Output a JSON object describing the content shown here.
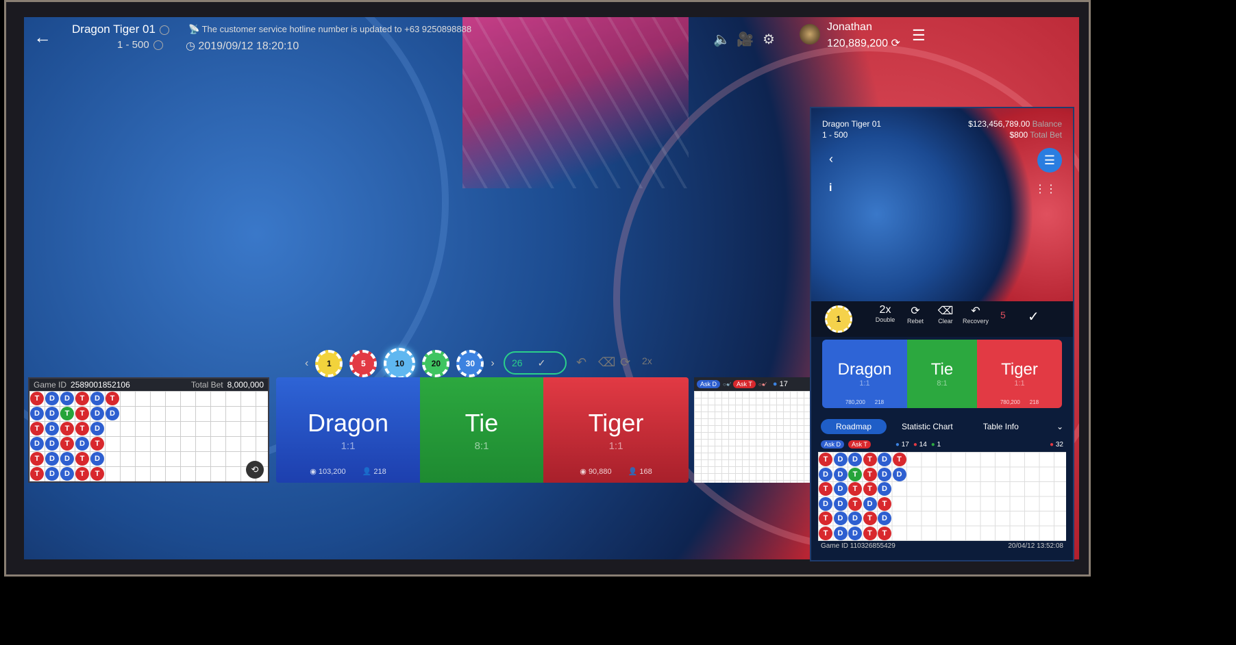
{
  "header": {
    "table_name": "Dragon Tiger 01",
    "limit": "1 - 500",
    "hotline": "The customer service hotline number is updated to +63 9250898888",
    "datetime": "2019/09/12 18:20:10",
    "username": "Jonathan",
    "balance": "120,889,200"
  },
  "chips": [
    "1",
    "5",
    "10",
    "20",
    "30"
  ],
  "counter": "26",
  "left_panel": {
    "game_id_label": "Game ID",
    "game_id": "2589001852106",
    "total_bet_label": "Total Bet",
    "total_bet": "8,000,000",
    "bead_rows": [
      [
        "T",
        "D",
        "D",
        "T",
        "D",
        "T"
      ],
      [
        "D",
        "D",
        "T",
        "T",
        "D",
        "D"
      ],
      [
        "T",
        "D",
        "T",
        "T",
        "D"
      ],
      [
        "D",
        "D",
        "T",
        "D",
        "T"
      ],
      [
        "T",
        "D",
        "D",
        "T",
        "D"
      ],
      [
        "T",
        "D",
        "D",
        "T",
        "T"
      ]
    ]
  },
  "bets": {
    "dragon": {
      "label": "Dragon",
      "odds": "1:1",
      "amount": "103,200",
      "players": "218"
    },
    "tie": {
      "label": "Tie",
      "odds": "8:1"
    },
    "tiger": {
      "label": "Tiger",
      "odds": "1:1",
      "amount": "90,880",
      "players": "168"
    }
  },
  "road_strip": {
    "ask_d": "Ask D",
    "ask_t": "Ask T",
    "count": "17"
  },
  "phone": {
    "table_name": "Dragon Tiger 01",
    "limit": "1 - 500",
    "balance": "$123,456,789.00",
    "balance_label": "Balance",
    "total_bet": "$800",
    "total_bet_label": "Total Bet",
    "chip": "1",
    "actions": [
      {
        "glyph": "2x",
        "label": "Double"
      },
      {
        "glyph": "⟳",
        "label": "Rebet"
      },
      {
        "glyph": "⌫",
        "label": "Clear"
      },
      {
        "glyph": "↶",
        "label": "Recovery"
      }
    ],
    "count": "5",
    "dragon": {
      "label": "Dragon",
      "odds": "1:1",
      "amount": "780,200",
      "players": "218"
    },
    "tie": {
      "label": "Tie",
      "odds": "8:1"
    },
    "tiger": {
      "label": "Tiger",
      "odds": "1:1",
      "amount": "780,200",
      "players": "218"
    },
    "tabs": [
      "Roadmap",
      "Statistic Chart",
      "Table Info"
    ],
    "ask_d": "Ask D",
    "ask_t": "Ask T",
    "dragon_count": "17",
    "tiger_count": "14",
    "tie_count": "1",
    "total_count": "32",
    "game_id_label": "Game ID",
    "game_id": "110326855429",
    "datetime": "20/04/12 13:52:08"
  }
}
